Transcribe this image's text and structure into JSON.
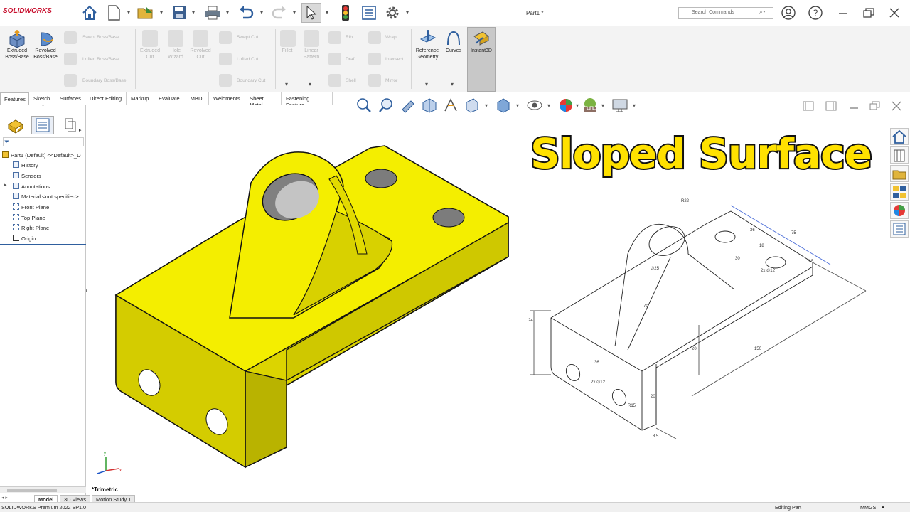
{
  "app": {
    "logo": "SOLIDWORKS",
    "document_title": "Part1 *",
    "search_placeholder": "Search Commands"
  },
  "ribbon": {
    "features_enabled": [
      {
        "label": "Extruded\nBoss/Base"
      },
      {
        "label": "Revolved\nBoss/Base"
      }
    ],
    "small_disabled": [
      "Swept Boss/Base",
      "Lofted Boss/Base",
      "Boundary Boss/Base"
    ],
    "cut_buttons": [
      "Extruded\nCut",
      "Hole\nWizard",
      "Revolved\nCut"
    ],
    "cut_small": [
      "Swept Cut",
      "Lofted Cut",
      "Boundary Cut"
    ],
    "fillet": "Fillet",
    "linear_pattern": "Linear\nPattern",
    "right_small": [
      "Rib",
      "Draft",
      "Shell",
      "Wrap",
      "Intersect",
      "Mirror"
    ],
    "reference_geometry": "Reference\nGeometry",
    "curves": "Curves",
    "instant3d": "Instant3D"
  },
  "tabs": [
    "Features",
    "Sketch",
    "Surfaces",
    "Direct Editing",
    "Markup",
    "Evaluate",
    "MBD",
    "Weldments",
    "Sheet Metal",
    "Fastening Feature"
  ],
  "tree": {
    "root": "Part1 (Default) <<Default>_D",
    "items": [
      "History",
      "Sensors",
      "Annotations",
      "Material <not specified>",
      "Front Plane",
      "Top Plane",
      "Right Plane",
      "Origin"
    ]
  },
  "viewport": {
    "view_label": "*Trimetric",
    "overlay_title": "Sloped Surface",
    "model_color": "#f5ee00",
    "drawing_dimensions": [
      "R22",
      "∅25",
      "36",
      "70",
      "2x ∅12",
      "18",
      "75",
      "8.5",
      "36",
      "20",
      "150",
      "24",
      "30",
      "2x ∅12",
      "20",
      "R15",
      "8.5"
    ]
  },
  "model_tabs": [
    "Model",
    "3D Views",
    "Motion Study 1"
  ],
  "status": {
    "left": "SOLIDWORKS Premium 2022 SP1.0",
    "editing": "Editing Part",
    "units": "MMGS"
  }
}
